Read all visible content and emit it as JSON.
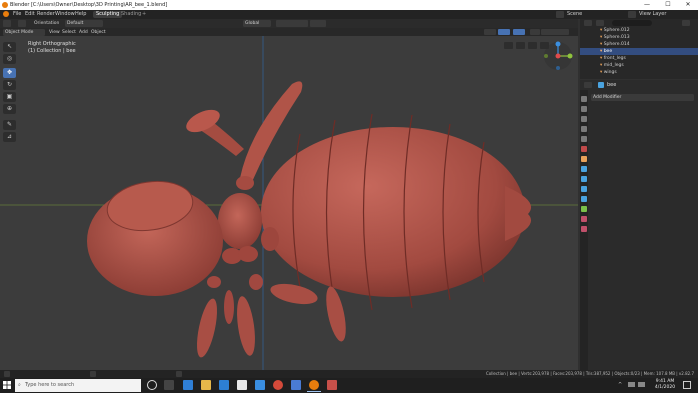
{
  "window": {
    "title": "Blender [C:\\Users\\Owner\\Desktop\\3D Printing\\AR_bee_1.blend]",
    "minimize": "—",
    "maximize": "☐",
    "close": "✕"
  },
  "menubar": {
    "items": [
      "File",
      "Edit",
      "Render",
      "Window",
      "Help"
    ],
    "workspaces": [
      "Sculpting",
      "Shading",
      "+"
    ],
    "scene_label": "Scene",
    "view_layer_label": "View Layer"
  },
  "header3d": {
    "orientation_label": "Orientation",
    "default_label": "Default",
    "transform_label": "Global",
    "mode_label": "Object Mode",
    "menus": [
      "View",
      "Select",
      "Add",
      "Object"
    ]
  },
  "viewport": {
    "view_name": "Right Orthographic",
    "collection_info": "(1) Collection | bee",
    "body_color": "#b5574c",
    "background_color": "#3c3c3c"
  },
  "outliner": {
    "search_placeholder": "",
    "rows": [
      {
        "label": "Sphere.012",
        "selected": false
      },
      {
        "label": "Sphere.013",
        "selected": false
      },
      {
        "label": "Sphere.014",
        "selected": false
      },
      {
        "label": "bee",
        "selected": true
      },
      {
        "label": "front_legs",
        "selected": false
      },
      {
        "label": "mid_legs",
        "selected": false
      },
      {
        "label": "wings",
        "selected": false
      }
    ]
  },
  "properties": {
    "object_name": "bee",
    "add_modifier_label": "Add Modifier"
  },
  "statusbar": {
    "info": "Collection | bee | Verts:203,978 | Faces:203,978 | Tris:387,952 | Objects:0/23 | Mem: 107.8 MB | v2.82.7"
  },
  "taskbar": {
    "search_placeholder": "Type here to search",
    "time": "9:41 AM",
    "date": "4/1/2020"
  },
  "colors": {
    "accent": "#4772b3",
    "selection": "#334d80",
    "blender_orange": "#e87d0d",
    "x_axis": "#e04b4b",
    "y_axis": "#8fc33d",
    "z_axis": "#3b8fe0"
  }
}
